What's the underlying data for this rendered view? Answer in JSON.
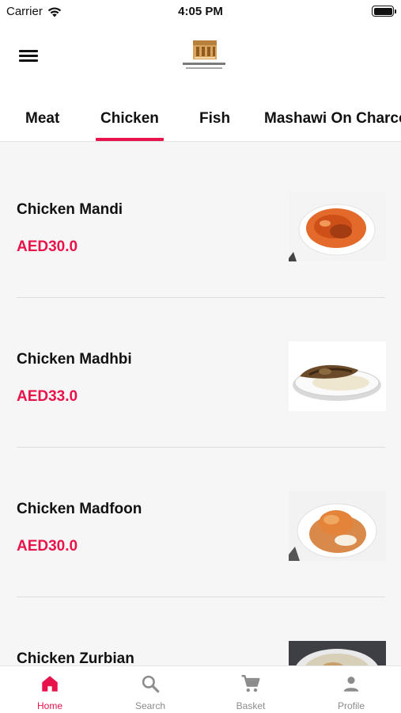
{
  "status_bar": {
    "carrier": "Carrier",
    "time": "4:05 PM"
  },
  "header": {
    "menu_icon": "hamburger-menu-icon",
    "logo": "restaurant-logo"
  },
  "tabs": [
    {
      "label": "Meat"
    },
    {
      "label": "Chicken",
      "active": true
    },
    {
      "label": "Fish"
    },
    {
      "label": "Mashawi On Charcoal"
    }
  ],
  "menu_items": [
    {
      "name": "Chicken Mandi",
      "price": "AED30.0"
    },
    {
      "name": "Chicken Madhbi",
      "price": "AED33.0"
    },
    {
      "name": "Chicken Madfoon",
      "price": "AED30.0"
    },
    {
      "name": "Chicken Zurbian",
      "price": ""
    }
  ],
  "bottom_nav": [
    {
      "label": "Home",
      "icon": "home-icon",
      "active": true
    },
    {
      "label": "Search",
      "icon": "search-icon"
    },
    {
      "label": "Basket",
      "icon": "cart-icon"
    },
    {
      "label": "Profile",
      "icon": "person-icon"
    }
  ],
  "colors": {
    "accent": "#e8134a",
    "background": "#f6f6f6",
    "inactive": "#8c8c8c"
  }
}
